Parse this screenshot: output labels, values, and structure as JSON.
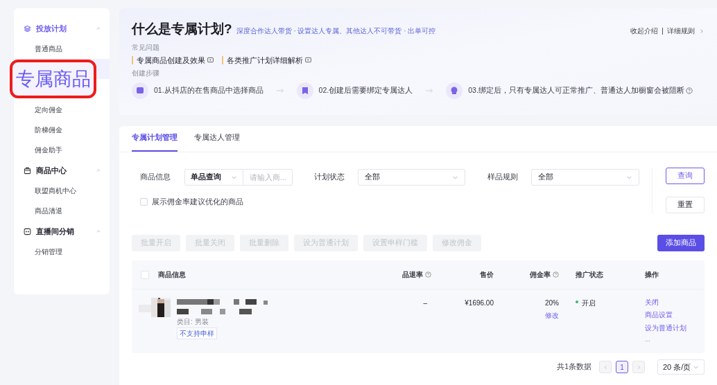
{
  "sidebar": {
    "groups": [
      {
        "title": "投放计划",
        "items": [
          {
            "label": "普通商品",
            "selected": false
          },
          {
            "selected": true
          }
        ]
      },
      {
        "items": [
          {
            "label": "定向佣金",
            "selected": false
          },
          {
            "label": "阶梯佣金",
            "selected": false
          },
          {
            "label": "佣金助手",
            "selected": false
          }
        ]
      },
      {
        "title": "商品中心",
        "items": [
          {
            "label": "联盟商机中心",
            "selected": false
          },
          {
            "label": "商品清退",
            "selected": false
          }
        ]
      },
      {
        "title": "直播间分销",
        "items": [
          {
            "label": "分销管理",
            "selected": false
          }
        ]
      }
    ]
  },
  "callout": {
    "text": "专属商品"
  },
  "intro": {
    "title": "什么是专属计划?",
    "subtitle": "深度合作达人带货 · 设置达人专属、其他达人不可带货 · 出单可控",
    "links": [
      "收起介绍",
      "详细规则"
    ],
    "faq_label": "常见问题",
    "faq": [
      "专属商品创建及效果",
      "各类推广计划详细解析"
    ],
    "steps_label": "创建步骤",
    "steps": [
      "01.从抖店的在售商品中选择商品",
      "02.创建后需要绑定专属达人",
      "03.绑定后，只有专属达人可正常推广、普通达人加橱窗会被阻断"
    ]
  },
  "tabs": [
    {
      "label": "专属计划管理",
      "selected": true
    },
    {
      "label": "专属达人管理",
      "selected": false
    }
  ],
  "filters": {
    "product_label": "商品信息",
    "query_type": "单品查询",
    "search_placeholder": "请输入商...",
    "status_label": "计划状态",
    "status_value": "全部",
    "sample_label": "样品规则",
    "sample_value": "全部",
    "checkbox": {
      "label": "展示佣金率建议优化的商品",
      "checked": false
    },
    "query_button": "查询",
    "reset_button": "重置"
  },
  "batch_buttons": [
    {
      "label": "批量开启",
      "disabled": true
    },
    {
      "label": "批量关闭",
      "disabled": true
    },
    {
      "label": "批量删除",
      "disabled": true
    },
    {
      "label": "设为普通计划",
      "disabled": true
    },
    {
      "label": "设置申样门槛",
      "disabled": true
    },
    {
      "label": "修改佣金",
      "disabled": true
    }
  ],
  "add_button": "添加商品",
  "table": {
    "select_all_checked": false,
    "columns": [
      "商品信息",
      "品退率",
      "售价",
      "佣金率",
      "推广状态",
      "操作"
    ],
    "rows": [
      {
        "checked": false,
        "category": "类目: 男装",
        "tag": "不支持申样",
        "return_rate": "–",
        "price": "¥1696.00",
        "commission": "20%",
        "commission_action": "修改",
        "status": "开启",
        "status_on": true,
        "actions": [
          "关闭",
          "商品设置",
          "设为普通计划",
          "..."
        ]
      }
    ]
  },
  "pagination": {
    "total": "共1条数据",
    "pages": [
      {
        "label": "1",
        "selected": true
      }
    ],
    "page_size": "20 条/页"
  }
}
